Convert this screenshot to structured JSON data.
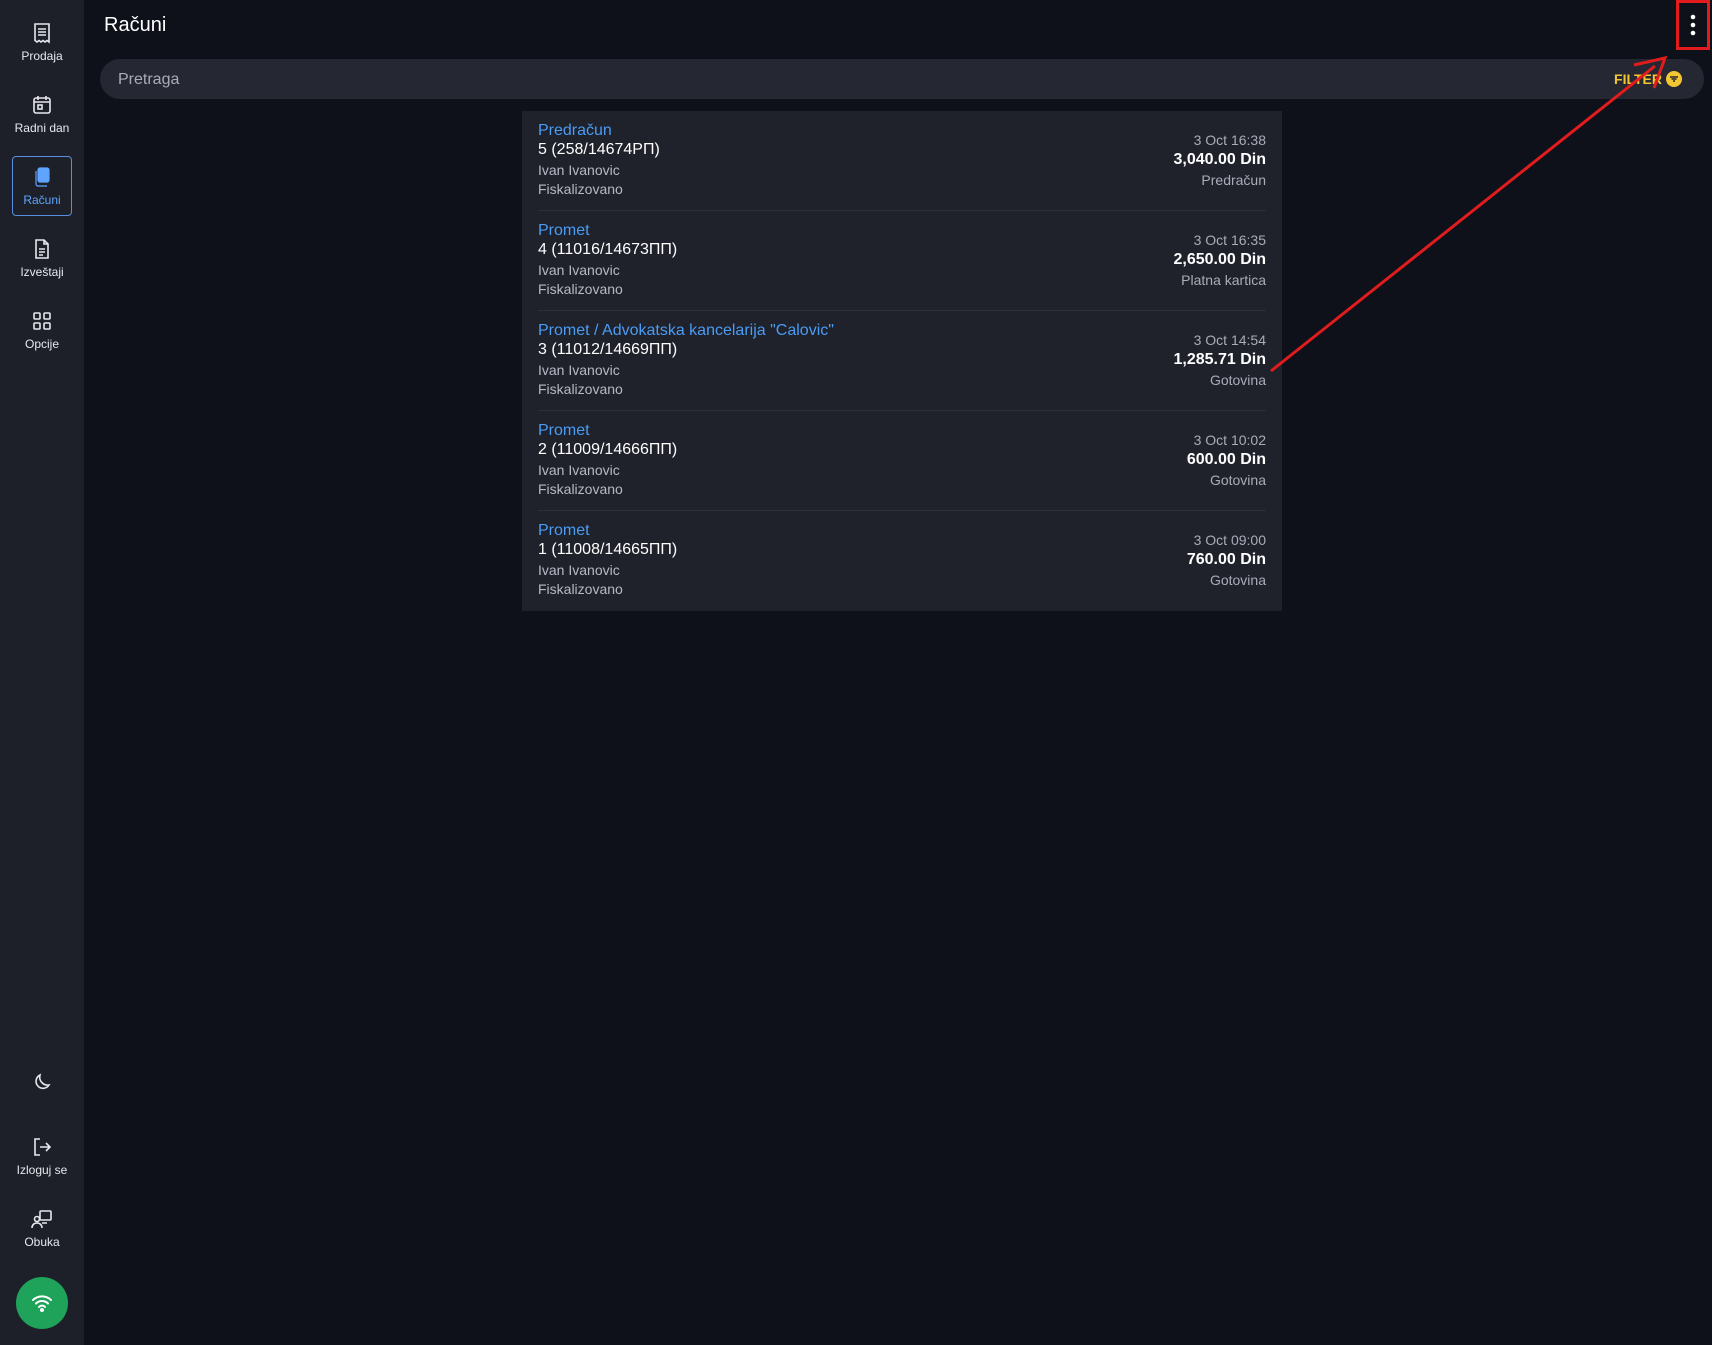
{
  "sidebar": {
    "items": [
      {
        "label": "Prodaja",
        "icon": "receipt-icon"
      },
      {
        "label": "Radni dan",
        "icon": "calendar-icon"
      },
      {
        "label": "Računi",
        "icon": "documents-icon",
        "active": true
      },
      {
        "label": "Izveštaji",
        "icon": "report-icon"
      },
      {
        "label": "Opcije",
        "icon": "grid-icon"
      }
    ],
    "bottom": [
      {
        "label": "",
        "icon": "moon-icon"
      },
      {
        "label": "Izloguj se",
        "icon": "logout-icon"
      },
      {
        "label": "Obuka",
        "icon": "training-icon"
      }
    ],
    "connection_icon": "wifi-icon",
    "connection_color": "#1fa35a"
  },
  "header": {
    "title": "Računi",
    "menu_icon": "more-vertical-icon"
  },
  "search": {
    "placeholder": "Pretraga",
    "filter_label": "FILTER"
  },
  "receipts": [
    {
      "type": "Predračun",
      "number": "5 (258/14674РП)",
      "user": "Ivan Ivanovic",
      "status": "Fiskalizovano",
      "date": "3 Oct 16:38",
      "amount": "3,040.00 Din",
      "method": "Predračun"
    },
    {
      "type": "Promet",
      "number": "4 (11016/14673ПП)",
      "user": "Ivan Ivanovic",
      "status": "Fiskalizovano",
      "date": "3 Oct 16:35",
      "amount": "2,650.00 Din",
      "method": "Platna kartica"
    },
    {
      "type": "Promet / Advokatska kancelarija \"Calovic\"",
      "number": "3 (11012/14669ПП)",
      "user": "Ivan Ivanovic",
      "status": "Fiskalizovano",
      "date": "3 Oct 14:54",
      "amount": "1,285.71 Din",
      "method": "Gotovina"
    },
    {
      "type": "Promet",
      "number": "2 (11009/14666ПП)",
      "user": "Ivan Ivanovic",
      "status": "Fiskalizovano",
      "date": "3 Oct 10:02",
      "amount": "600.00 Din",
      "method": "Gotovina"
    },
    {
      "type": "Promet",
      "number": "1 (11008/14665ПП)",
      "user": "Ivan Ivanovic",
      "status": "Fiskalizovano",
      "date": "3 Oct 09:00",
      "amount": "760.00 Din",
      "method": "Gotovina"
    }
  ],
  "colors": {
    "accent": "#4a9cf5",
    "filter": "#f3c531",
    "annotation": "#e21c1c"
  }
}
